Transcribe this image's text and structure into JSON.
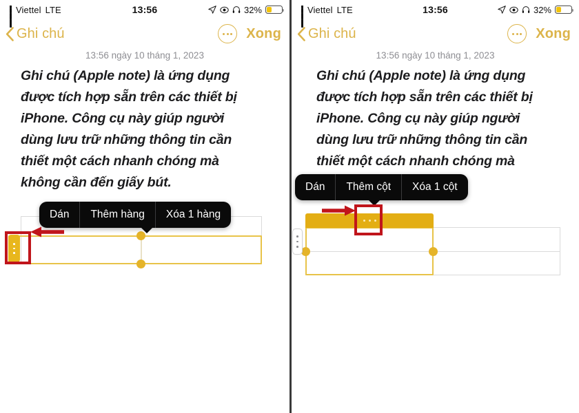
{
  "meta": {
    "app": "Apple Notes (Ghi chú)",
    "panel_count": 2
  },
  "status_bar": {
    "carrier": "Viettel",
    "radio": "LTE",
    "time": "13:56",
    "battery_percent": "32%",
    "battery_level": 32,
    "icons": [
      "signal-bars-icon",
      "location-arrow-icon",
      "eye-icon",
      "headphones-icon",
      "battery-icon"
    ]
  },
  "nav_bar": {
    "back_label": "Ghi chú",
    "back_icon": "chevron-left-icon",
    "more_icon": "ellipsis-circle-icon",
    "done_label": "Xong"
  },
  "note": {
    "date": "13:56 ngày 10 tháng 1, 2023",
    "body_lines": [
      "Ghi chú (Apple note) là ứng dụng",
      "được tích hợp sẵn trên các thiết bị",
      "iPhone. Công cụ này giúp người",
      "dùng lưu trữ những thông tin cần",
      "thiết một cách nhanh chóng mà",
      "không cần đến giấy bút."
    ],
    "body_text": "Ghi chú (Apple note) là ứng dụng được tích hợp sẵn trên các thiết bị iPhone. Công cụ này giúp người dùng lưu trữ những thông tin cần thiết một cách nhanh chóng mà không cần đến giấy bút."
  },
  "left_panel": {
    "context_menu": {
      "items": [
        {
          "label": "Dán",
          "name": "menu-item-paste"
        },
        {
          "label": "Thêm hàng",
          "name": "menu-item-add-row"
        },
        {
          "label": "Xóa 1 hàng",
          "name": "menu-item-delete-row"
        }
      ]
    },
    "table": {
      "selection": "row",
      "handle_icon": "row-handle-vertical-dots-icon",
      "cells": [
        [
          "",
          ""
        ],
        [
          "",
          ""
        ]
      ]
    },
    "annotation": {
      "highlight_target": "row-handle",
      "arrow_direction": "left",
      "color": "#c0151b"
    }
  },
  "right_panel": {
    "context_menu": {
      "items": [
        {
          "label": "Dán",
          "name": "menu-item-paste"
        },
        {
          "label": "Thêm cột",
          "name": "menu-item-add-column"
        },
        {
          "label": "Xóa 1 cột",
          "name": "menu-item-delete-column"
        }
      ]
    },
    "table": {
      "selection": "column",
      "column_handle_icon": "column-handle-horizontal-dots-icon",
      "row_handle_icon": "row-handle-vertical-dots-icon",
      "cells": [
        [
          "",
          ""
        ],
        [
          "",
          ""
        ]
      ]
    },
    "annotation": {
      "highlight_target": "column-handle",
      "arrow_direction": "right",
      "color": "#c0151b"
    }
  },
  "colors": {
    "accent_gold": "#dcb44a",
    "table_gold": "#e3ae14",
    "selection_gold": "#e8c348",
    "menu_bg": "#0a0a0a",
    "annotation_red": "#c0151b",
    "battery_yellow": "#f2c30d",
    "grid_gray": "#dadada"
  }
}
